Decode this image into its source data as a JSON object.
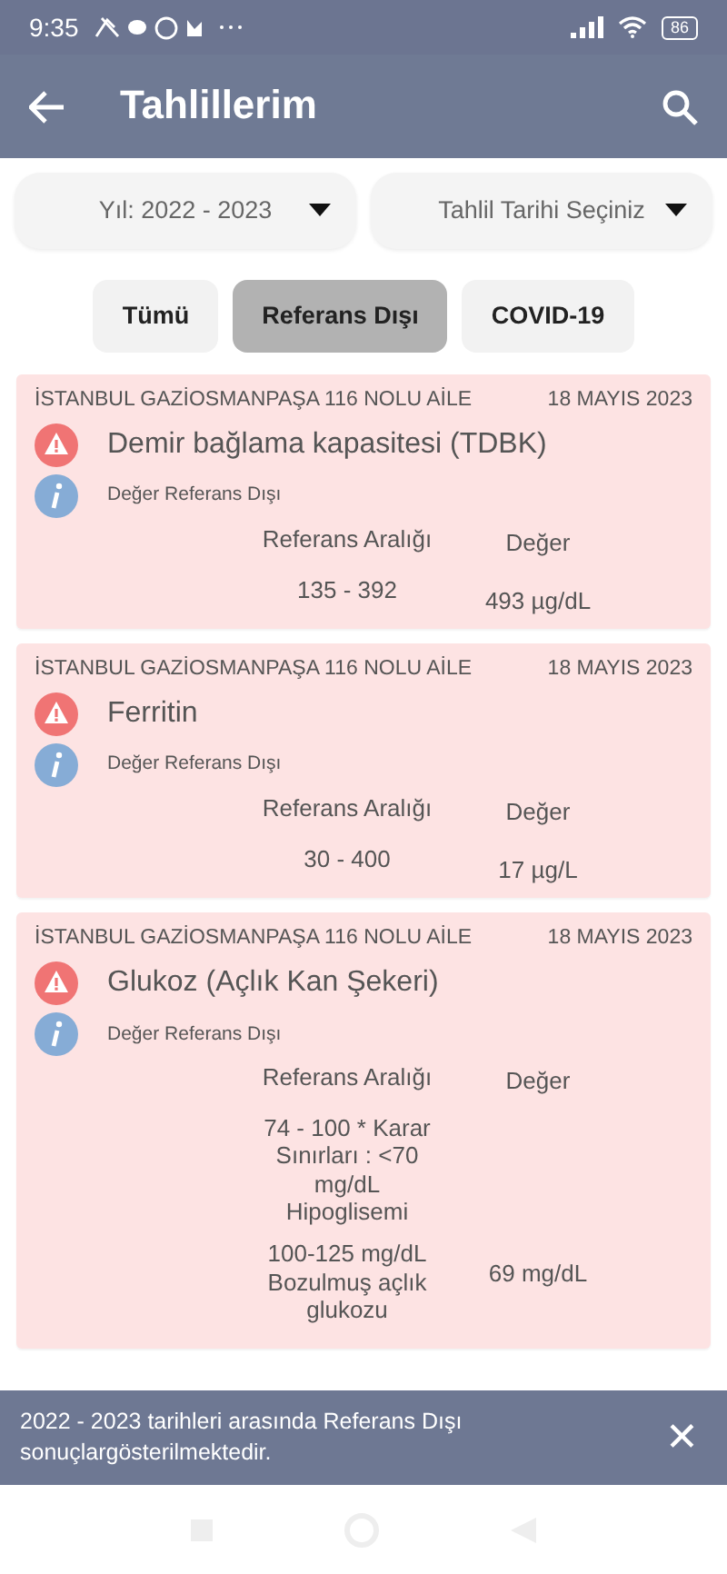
{
  "status_bar": {
    "time": "9:35",
    "battery": "86"
  },
  "app_bar": {
    "title": "Tahlillerim"
  },
  "filters": [
    {
      "label": "Yıl: 2022 - 2023"
    },
    {
      "label": "Tahlil Tarihi Seçiniz"
    }
  ],
  "chips": [
    {
      "label": "Tümü",
      "selected": false
    },
    {
      "label": "Referans Dışı",
      "selected": true
    },
    {
      "label": "COVID-19",
      "selected": false
    }
  ],
  "results": [
    {
      "institution": "İSTANBUL GAZİOSMANPAŞA 116 NOLU AİLE",
      "date": "18 MAYIS 2023",
      "test": "Demir bağlama kapasitesi (TDBK)",
      "status": "Değer Referans Dışı",
      "range_label": "Referans Aralığı",
      "value_label": "Değer",
      "range": [
        "135 - 392"
      ],
      "value": "493 µg/dL"
    },
    {
      "institution": "İSTANBUL GAZİOSMANPAŞA 116 NOLU AİLE",
      "date": "18 MAYIS 2023",
      "test": "Ferritin",
      "status": "Değer Referans Dışı",
      "range_label": "Referans Aralığı",
      "value_label": "Değer",
      "range": [
        "30 - 400"
      ],
      "value": "17 µg/L"
    },
    {
      "institution": "İSTANBUL GAZİOSMANPAŞA 116 NOLU AİLE",
      "date": "18 MAYIS 2023",
      "test": "Glukoz (Açlık Kan Şekeri)",
      "status": "Değer Referans Dışı",
      "range_label": "Referans Aralığı",
      "value_label": "Değer",
      "range": [
        "74 - 100 * Karar Sınırları : <70 mg/dL Hipoglisemi",
        "100-125 mg/dL Bozulmuş açlık glukozu"
      ],
      "value": "69 mg/dL"
    }
  ],
  "snackbar": {
    "message": "2022 - 2023 tarihleri arasında Referans Dışı sonuçlargösterilmektedir.",
    "close": "✕"
  }
}
